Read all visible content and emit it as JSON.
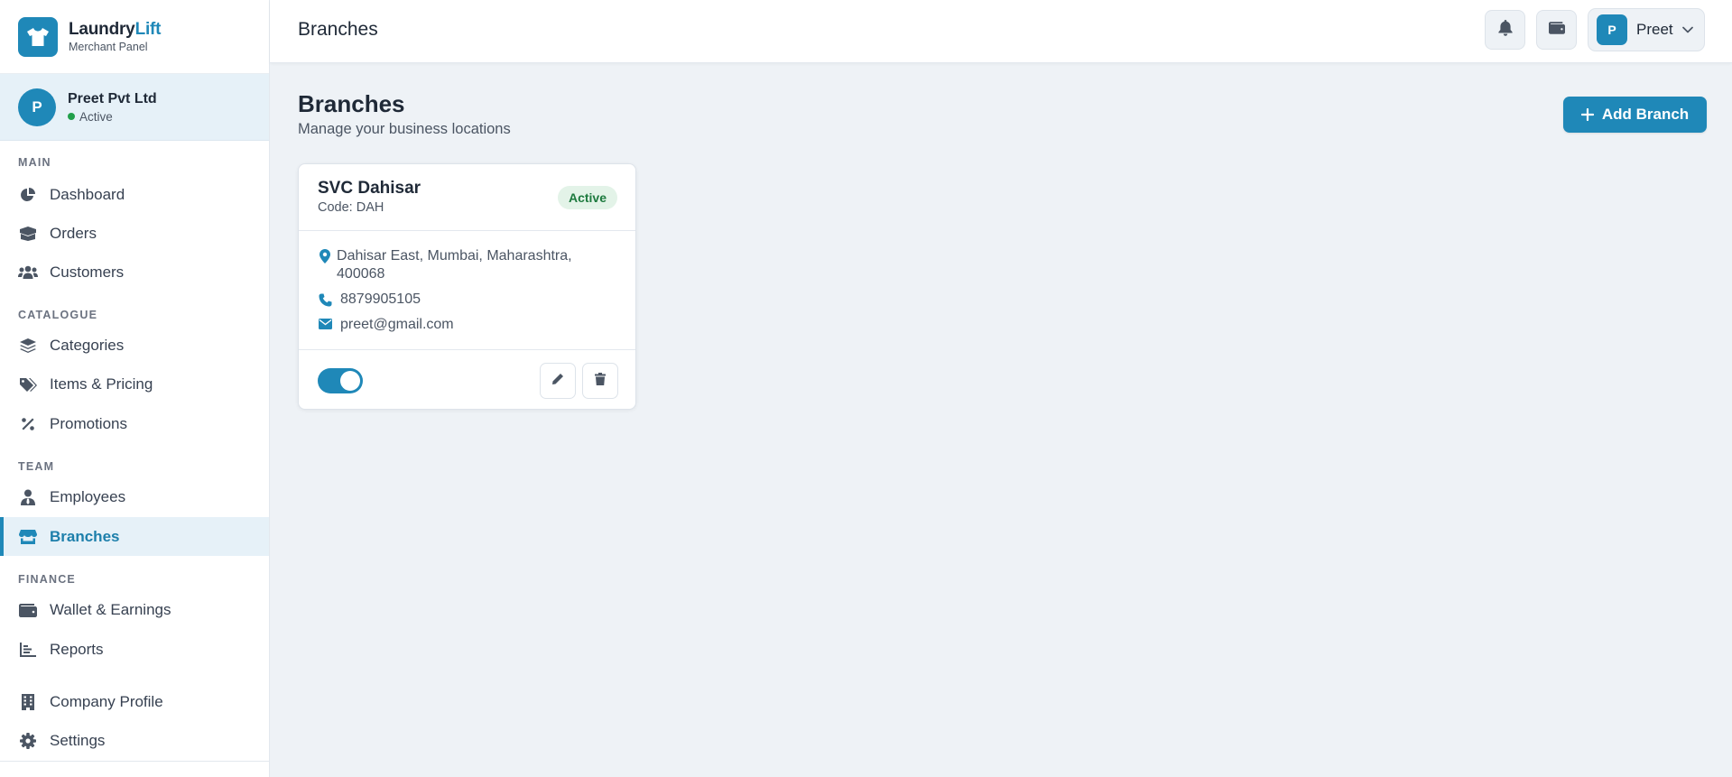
{
  "brand": {
    "name_part1": "Laundry",
    "name_part2": "Lift",
    "subtitle": "Merchant Panel"
  },
  "company": {
    "initial": "P",
    "name": "Preet Pvt Ltd",
    "status": "Active"
  },
  "sidebar": {
    "sections": [
      {
        "title": "MAIN",
        "items": [
          "Dashboard",
          "Orders",
          "Customers"
        ]
      },
      {
        "title": "CATALOGUE",
        "items": [
          "Categories",
          "Items & Pricing",
          "Promotions"
        ]
      },
      {
        "title": "TEAM",
        "items": [
          "Employees",
          "Branches"
        ]
      },
      {
        "title": "FINANCE",
        "items": [
          "Wallet & Earnings",
          "Reports"
        ]
      },
      {
        "title": "",
        "items": [
          "Company Profile",
          "Settings"
        ]
      }
    ],
    "active_item": "Branches"
  },
  "header": {
    "title": "Branches",
    "user": {
      "initial": "P",
      "name": "Preet"
    }
  },
  "main": {
    "title": "Branches",
    "subtitle": "Manage your business locations",
    "add_button_label": "Add Branch"
  },
  "branches": [
    {
      "name": "SVC Dahisar",
      "code": "Code: DAH",
      "status": "Active",
      "address": "Dahisar East, Mumbai, Maharashtra, 400068",
      "phone": "8879905105",
      "email": "preet@gmail.com",
      "enabled": true
    }
  ],
  "colors": {
    "accent": "#1f88b8",
    "active_badge_bg": "#e3f3e8",
    "active_badge_text": "#1d7a3e",
    "status_dot": "#22a04b"
  }
}
